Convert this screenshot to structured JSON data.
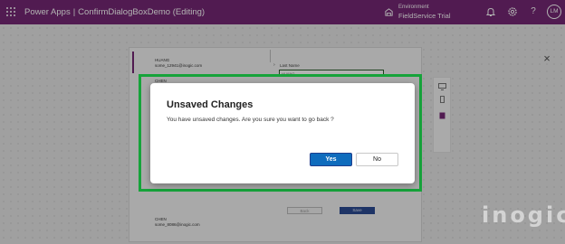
{
  "topbar": {
    "app_name": "Power Apps",
    "separator": "|",
    "app_title": "ConfirmDialogBoxDemo (Editing)",
    "environment_label": "Environment",
    "environment_name": "FieldService Trial",
    "avatar_initials": "LM",
    "icons": [
      "waffle-icon",
      "environment-icon",
      "bell-icon",
      "settings-icon",
      "help-icon"
    ],
    "color": "#742774"
  },
  "canvas": {
    "records": [
      {
        "name": "HUANG",
        "email": "some_12941@inogic.com"
      },
      {
        "name": "CHEN",
        "email": ""
      },
      {
        "name": "CHEN",
        "email": "some_8086@inogic.com"
      }
    ],
    "field_label": "Last Name",
    "field_value": "HUANG",
    "back_label": "Back",
    "save_label": "Save"
  },
  "side_panel": {
    "icons": [
      "monitor-icon",
      "phone-icon",
      "tablet-icon"
    ]
  },
  "dialog": {
    "title": "Unsaved Changes",
    "message": "You have unsaved changes. Are you sure you want to go back ?",
    "yes_label": "Yes",
    "no_label": "No",
    "primary_color": "#0f6cbd",
    "highlight_color": "#16a33a"
  },
  "watermark": "inogic"
}
